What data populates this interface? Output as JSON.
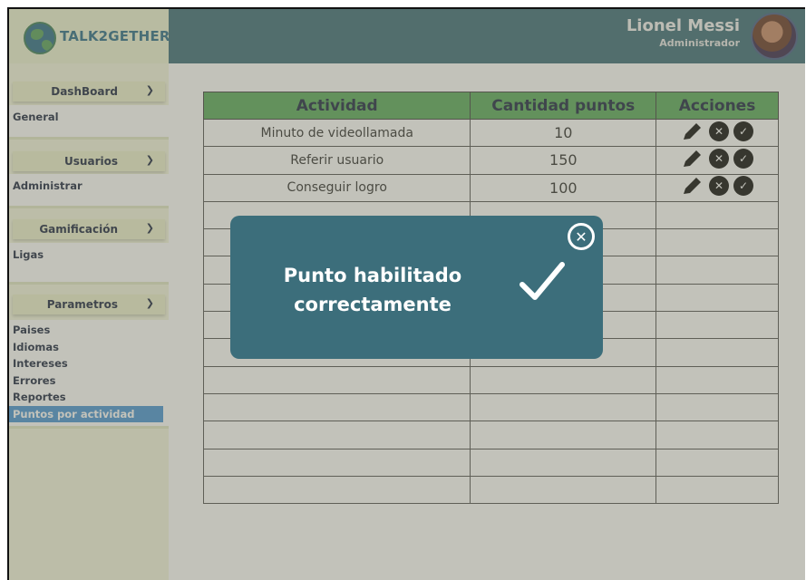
{
  "app": {
    "logo_text": "TALK2GETHER",
    "logo_icon": "globe-icon"
  },
  "user": {
    "name": "Lionel Messi",
    "role": "Administrador"
  },
  "sidebar": {
    "sections": [
      {
        "title": "DashBoard",
        "items": [
          "General"
        ]
      },
      {
        "title": "Usuarios",
        "items": [
          "Administrar"
        ]
      },
      {
        "title": "Gamificación",
        "items": [
          "Ligas"
        ]
      },
      {
        "title": "Parametros",
        "items": [
          "Paises",
          "Idiomas",
          "Intereses",
          "Errores",
          "Reportes",
          "Puntos por actividad"
        ]
      }
    ],
    "active_item": "Puntos por actividad"
  },
  "table": {
    "headers": [
      "Actividad",
      "Cantidad puntos",
      "Acciones"
    ],
    "rows": [
      {
        "actividad": "Minuto de videollamada",
        "puntos": "10"
      },
      {
        "actividad": "Referir usuario",
        "puntos": "150"
      },
      {
        "actividad": "Conseguir logro",
        "puntos": "100"
      }
    ],
    "empty_rows": 11,
    "action_icons": [
      "pencil-icon",
      "close-circle-icon",
      "check-circle-icon"
    ]
  },
  "modal": {
    "message_line1": "Punto habilitado",
    "message_line2": "correctamente",
    "close_icon": "close-circle-icon",
    "check_icon": "checkmark-icon"
  },
  "colors": {
    "header": "#3f6e7a",
    "table_header": "#5cab5e",
    "modal_bg": "#3c6e7b",
    "active_item": "#4a96d6"
  }
}
